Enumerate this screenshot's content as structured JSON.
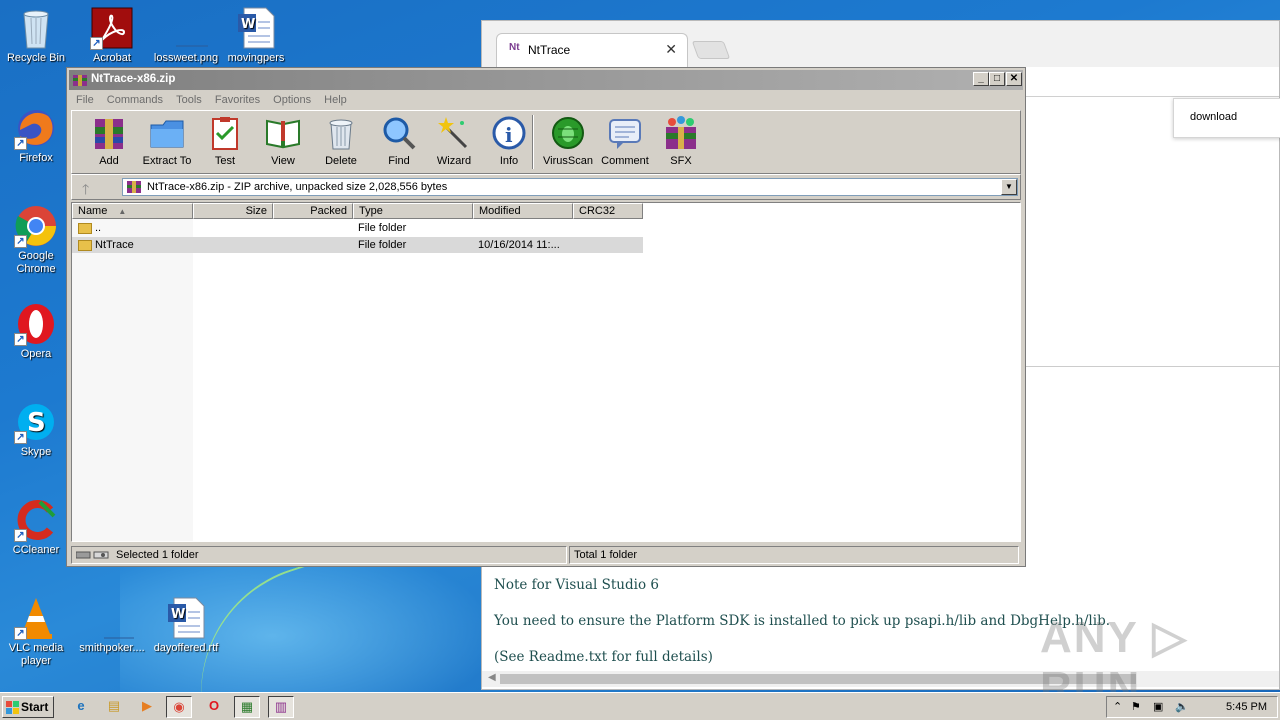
{
  "desktop": {
    "icons": [
      {
        "label": "Recycle Bin"
      },
      {
        "label": "Acrobat"
      },
      {
        "label": "lossweet.png"
      },
      {
        "label": "movingpers"
      },
      {
        "label": "Firefox"
      },
      {
        "label": "Google Chrome"
      },
      {
        "label": "Opera"
      },
      {
        "label": "Skype"
      },
      {
        "label": "CCleaner"
      },
      {
        "label": "VLC media player"
      },
      {
        "label": "smithpoker...."
      },
      {
        "label": "dayoffered.rtf"
      }
    ]
  },
  "browser": {
    "tab_title": "NtTrace",
    "tab_favicon": "Nt",
    "tab_close": "✕",
    "download_popup": "download",
    "content_lines": [
      "Note for Visual Studio 6",
      "You need to ensure the Platform SDK is installed to pick up psapi.h/lib and DbgHelp.h/lib.",
      "(See Readme.txt for full details)"
    ]
  },
  "watermark": "ANY ▷ RUN",
  "winrar": {
    "title": "NtTrace-x86.zip",
    "menu": [
      "File",
      "Commands",
      "Tools",
      "Favorites",
      "Options",
      "Help"
    ],
    "toolbar": [
      {
        "label": "Add",
        "icon": "add-icon"
      },
      {
        "label": "Extract To",
        "icon": "extract-to-icon"
      },
      {
        "label": "Test",
        "icon": "test-icon"
      },
      {
        "label": "View",
        "icon": "view-icon"
      },
      {
        "label": "Delete",
        "icon": "delete-icon"
      },
      {
        "label": "Find",
        "icon": "find-icon"
      },
      {
        "label": "Wizard",
        "icon": "wizard-icon"
      },
      {
        "label": "Info",
        "icon": "info-icon"
      },
      {
        "label": "VirusScan",
        "icon": "virusscan-icon"
      },
      {
        "label": "Comment",
        "icon": "comment-icon"
      },
      {
        "label": "SFX",
        "icon": "sfx-icon"
      }
    ],
    "path": "NtTrace-x86.zip - ZIP archive, unpacked size 2,028,556 bytes",
    "columns": [
      "Name",
      "Size",
      "Packed",
      "Type",
      "Modified",
      "CRC32"
    ],
    "rows": [
      {
        "name": "..",
        "size": "",
        "packed": "",
        "type": "File folder",
        "modified": "",
        "crc": ""
      },
      {
        "name": "NtTrace",
        "size": "",
        "packed": "",
        "type": "File folder",
        "modified": "10/16/2014 11:...",
        "crc": ""
      }
    ],
    "status_left": "Selected 1 folder",
    "status_right": "Total 1 folder"
  },
  "taskbar": {
    "start": "Start",
    "apps": [
      {
        "name": "ie",
        "glyph": "e"
      },
      {
        "name": "explorer",
        "glyph": "▤"
      },
      {
        "name": "media-player",
        "glyph": "▶"
      },
      {
        "name": "chrome",
        "glyph": "◉"
      },
      {
        "name": "opera",
        "glyph": "O"
      },
      {
        "name": "task-manager",
        "glyph": "▦"
      },
      {
        "name": "winrar",
        "glyph": "▥"
      }
    ],
    "clock": "5:45 PM"
  }
}
